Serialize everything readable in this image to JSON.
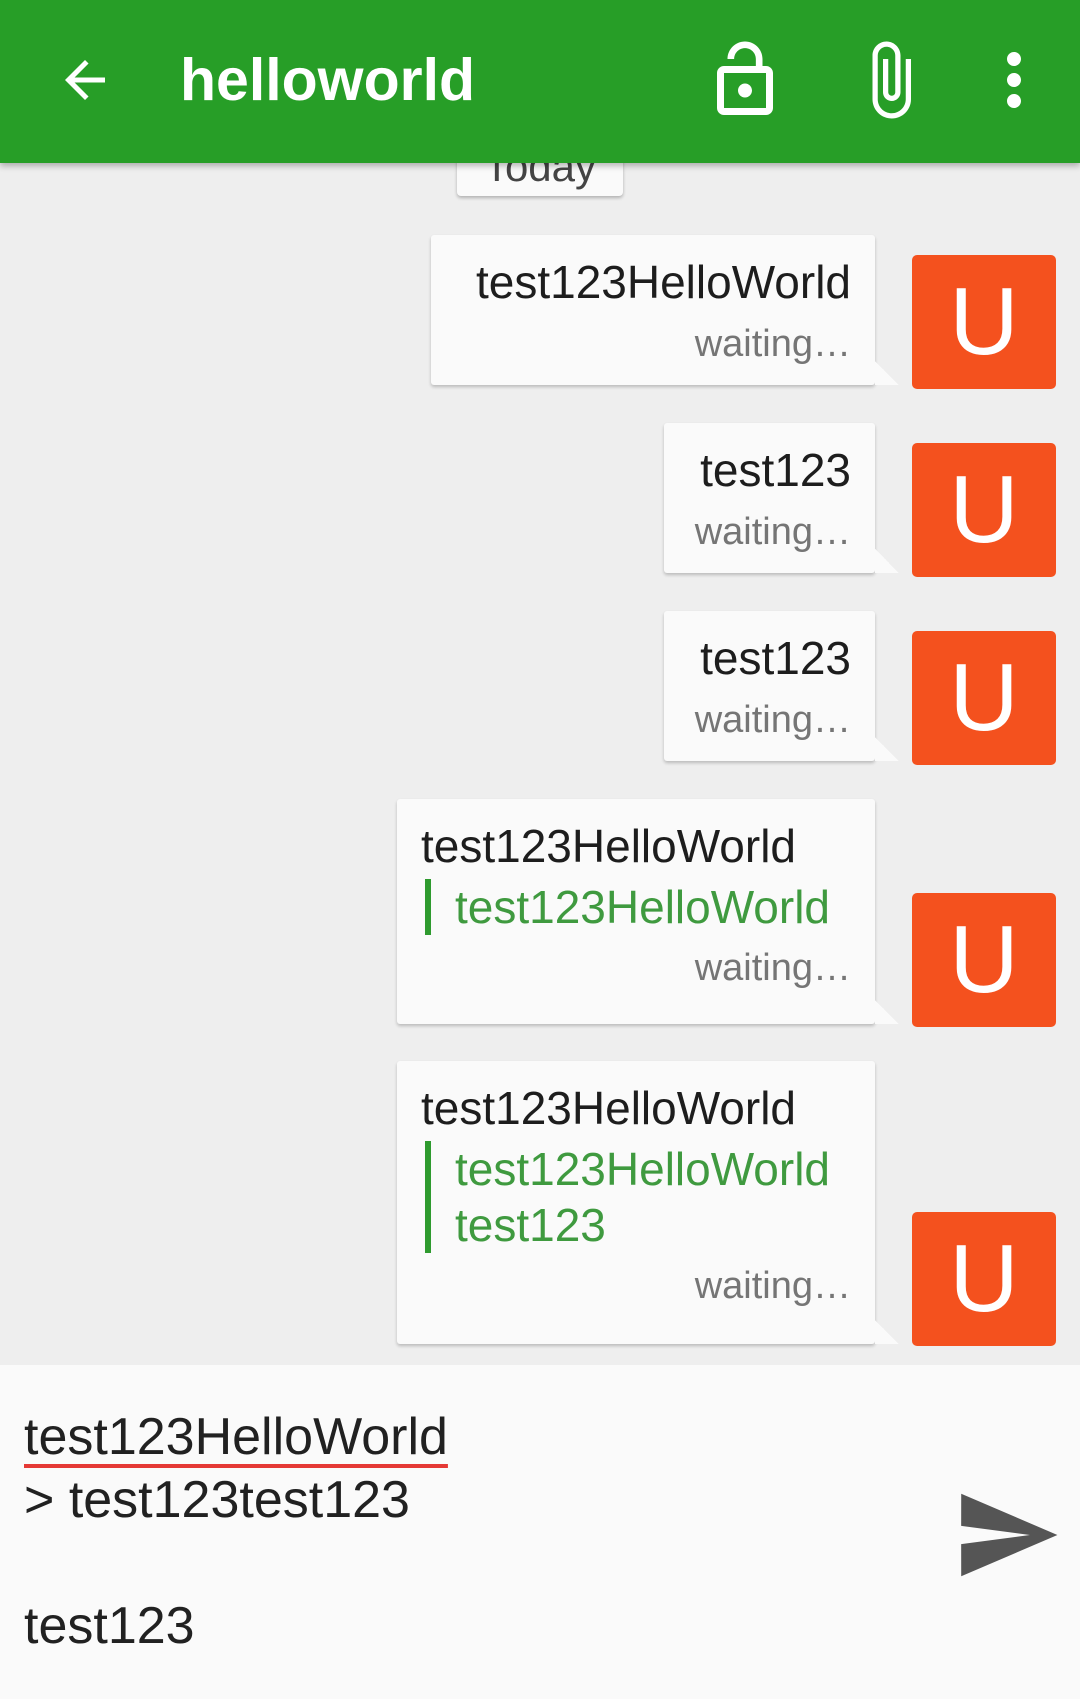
{
  "appbar": {
    "title": "helloworld",
    "back_icon": "arrow-back-icon",
    "actions": [
      "lock-icon",
      "attach-icon",
      "more-vert-icon"
    ],
    "color": "#279e27"
  },
  "day_separator": "Today",
  "avatar_color": "#f4511e",
  "quote_color": "#2e9a2e",
  "messages": [
    {
      "text": "test123HelloWorld",
      "quote": [],
      "status": "waiting…",
      "avatar": "U"
    },
    {
      "text": "test123",
      "quote": [],
      "status": "waiting…",
      "avatar": "U"
    },
    {
      "text": "test123",
      "quote": [],
      "status": "waiting…",
      "avatar": "U"
    },
    {
      "text": "test123HelloWorld",
      "quote": [
        "test123HelloWorld"
      ],
      "status": "waiting…",
      "avatar": "U"
    },
    {
      "text": "test123HelloWorld",
      "quote": [
        "test123HelloWorld",
        "test123"
      ],
      "status": "waiting…",
      "avatar": "U"
    }
  ],
  "composer": {
    "line1": "test123HelloWorld",
    "line2": "> test123test123",
    "line3": "",
    "line4": "test123",
    "send_icon": "send-icon"
  }
}
